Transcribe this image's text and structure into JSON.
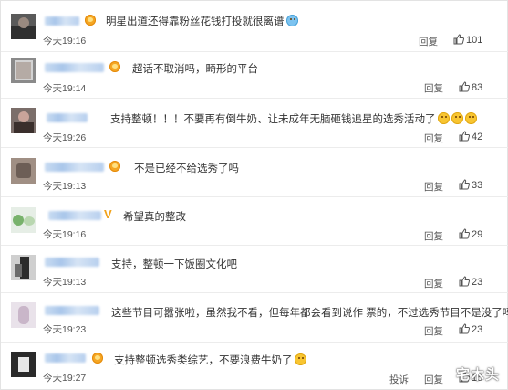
{
  "comments": [
    {
      "text": "明星出道还得靠粉丝花钱打投就很离谱",
      "time": "今天19:16",
      "reply": "回复",
      "likes": "101"
    },
    {
      "text": "超话不取消吗，畸形的平台",
      "time": "今天19:14",
      "reply": "回复",
      "likes": "83"
    },
    {
      "text": "支持整顿！！！不要再有倒牛奶、让未成年无脑砸钱追星的选秀活动了",
      "time": "今天19:26",
      "reply": "回复",
      "likes": "42"
    },
    {
      "text": "不是已经不给选秀了吗",
      "time": "今天19:13",
      "reply": "回复",
      "likes": "33"
    },
    {
      "text": "希望真的整改",
      "time": "今天19:16",
      "reply": "回复",
      "likes": "29"
    },
    {
      "text": "支持，整顿一下饭圈文化吧",
      "time": "今天19:13",
      "reply": "回复",
      "likes": "23"
    },
    {
      "text": "这些节目可嚣张啦，虽然我不看，但每年都会看到说作 票的，不过选秀节目不是没了吗?",
      "time": "今天19:23",
      "reply": "回复",
      "likes": "23"
    },
    {
      "text": "支持整顿选秀类综艺，不要浪费牛奶了",
      "time": "今天19:27",
      "reply": "回复",
      "report": "投诉",
      "likes": "15"
    }
  ],
  "watermark": "宅木头",
  "colors": {
    "vip_badge": "#f5a623",
    "verified_v": "#f1a21b",
    "name_blur": "#b7cfee"
  },
  "icons": [
    "vip-badge-icon",
    "verified-v-icon",
    "thumbs-up-icon",
    "smile-emoji-icon",
    "cry-emoji-icon"
  ]
}
